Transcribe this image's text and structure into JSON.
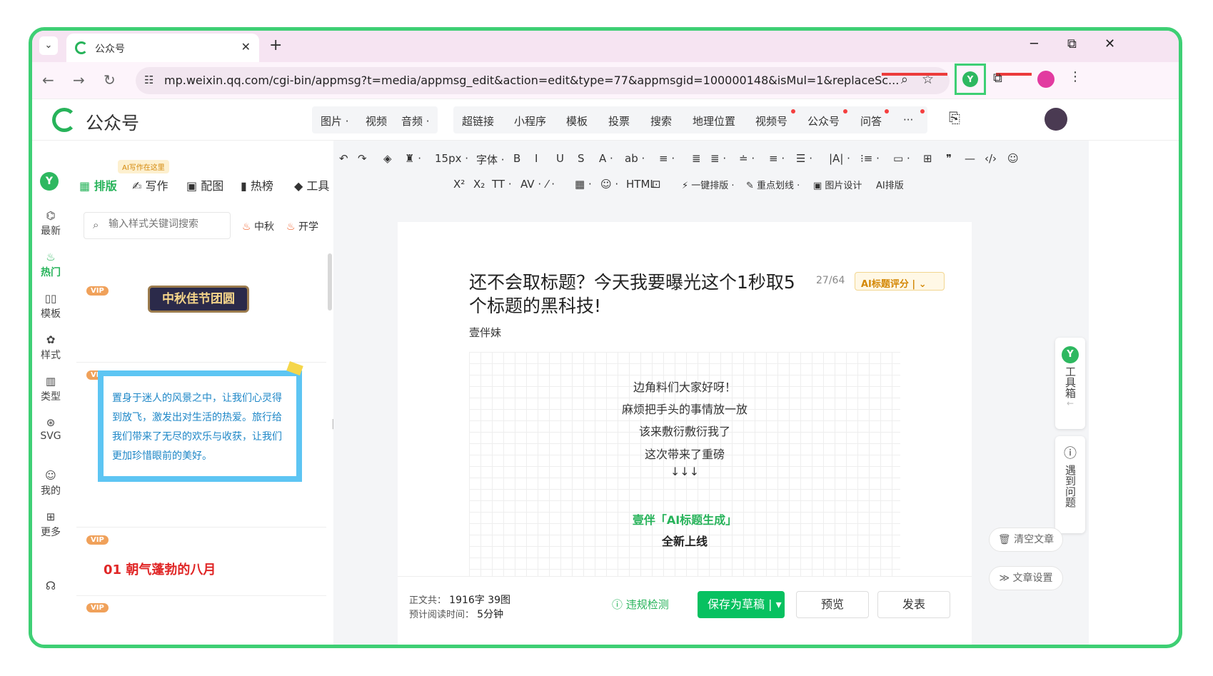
{
  "browser": {
    "tab_title": "公众号",
    "url": "mp.weixin.qq.com/cgi-bin/appmsg?t=media/appmsg_edit&action=edit&type=77&appmsgid=100000148&isMul=1&replaceSc...",
    "minimize": "─",
    "restore": "⧉",
    "close": "✕",
    "new_tab": "+",
    "tab_close": "✕"
  },
  "header": {
    "title": "公众号",
    "menu_group1": [
      "图片 ·",
      "视频",
      "音频 ·"
    ],
    "menu_group2": [
      "超链接",
      "小程序",
      "模板",
      "投票",
      "搜索",
      "地理位置",
      "视频号",
      "公众号",
      "问答",
      "···"
    ]
  },
  "leftnav": [
    {
      "icon": "⌬",
      "label": "最新"
    },
    {
      "icon": "♨",
      "label": "热门"
    },
    {
      "icon": "▯▯",
      "label": "模板"
    },
    {
      "icon": "✿",
      "label": "样式"
    },
    {
      "icon": "▥",
      "label": "类型"
    },
    {
      "icon": "⊛",
      "label": "SVG"
    },
    {
      "icon": "☺",
      "label": "我的"
    },
    {
      "icon": "⊞",
      "label": "更多"
    }
  ],
  "panel": {
    "tabs": [
      "排版",
      "写作",
      "配图",
      "热榜",
      "工具"
    ],
    "ai_tip": "AI写作在这里",
    "search_placeholder": "输入样式关键词搜索",
    "hot_tags": [
      "中秋",
      "开学"
    ],
    "vip": "VIP",
    "card1": "中秋佳节团圆",
    "card2": "置身于迷人的风景之中，让我们心灵得到放飞，激发出对生活的热爱。旅行给我们带来了无尽的欢乐与收获，让我们更加珍惜眼前的美好。",
    "card3": "01  朝气蓬勃的八月"
  },
  "toolbar": {
    "row1": [
      "↶",
      "↷",
      "◈",
      "♜ ·",
      "15px ·",
      "字体 ·",
      "B",
      "I",
      "U",
      "S",
      "A ·",
      "ab ·",
      "≡ ·",
      "≣",
      "≣ ·",
      "≐ ·",
      "≡ ·",
      "☰ ·",
      "|A| ·",
      "⁝≡ ·",
      "▭ ·",
      "⊞",
      "❞",
      "—",
      "‹/›",
      "☺"
    ],
    "row2": [
      "X²",
      "X₂",
      "TT ·",
      "AV ·",
      "⁄ ·",
      "▦ ·",
      "☺ ·",
      "HTML",
      "⊡",
      "⚡ 一键排版 ·",
      "✎ 重点划线 ·",
      "▣ 图片设计",
      "AI排版"
    ]
  },
  "editor": {
    "title": "还不会取标题？今天我要曝光这个1秒取5个标题的黑科技!",
    "count": "27/64",
    "ai_score": "AI标题评分 | ⌄",
    "author": "壹伴妹",
    "lines": [
      "边角料们大家好呀！",
      "麻烦把手头的事情放一放",
      "该来敷衍敷衍我了",
      "这次带来了重磅",
      "↓↓↓",
      "",
      "壹伴「AI标题生成」",
      "全新上线"
    ]
  },
  "bottombar": {
    "word_label": "正文共：",
    "word_value": "1916字 39图",
    "time_label": "预计阅读时间：",
    "time_value": "5分钟",
    "check": "违规检测",
    "save": "保存为草稿",
    "preview": "预览",
    "publish": "发表"
  },
  "right": {
    "toolbox": "工具箱",
    "help": "遇到问题",
    "clear": "清空文章",
    "settings": "文章设置"
  }
}
